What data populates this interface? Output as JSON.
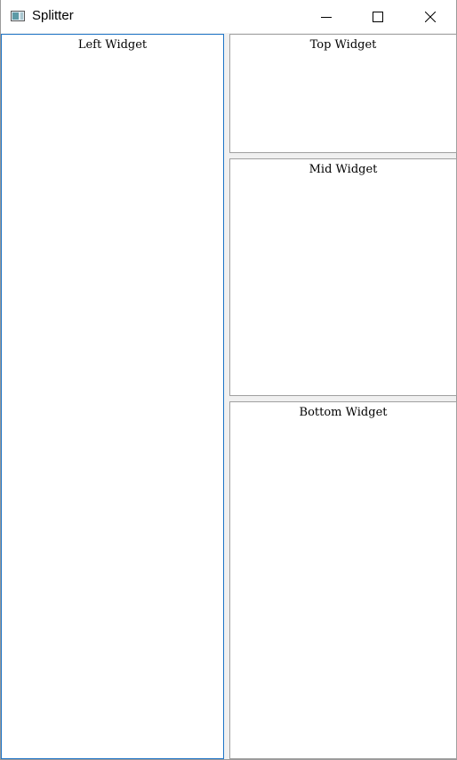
{
  "window": {
    "title": "Splitter",
    "icon": "splitter-app-icon",
    "controls": {
      "minimize_icon": "minimize-icon",
      "maximize_icon": "maximize-icon",
      "close_icon": "close-icon"
    }
  },
  "panes": {
    "left": {
      "label": "Left Widget"
    },
    "top": {
      "label": "Top Widget"
    },
    "mid": {
      "label": "Mid Widget"
    },
    "bottom": {
      "label": "Bottom Widget"
    }
  },
  "colors": {
    "focus_border": "#1e74c6",
    "pane_border": "#a0a0a0",
    "splitter_background": "#f0f0f0"
  }
}
